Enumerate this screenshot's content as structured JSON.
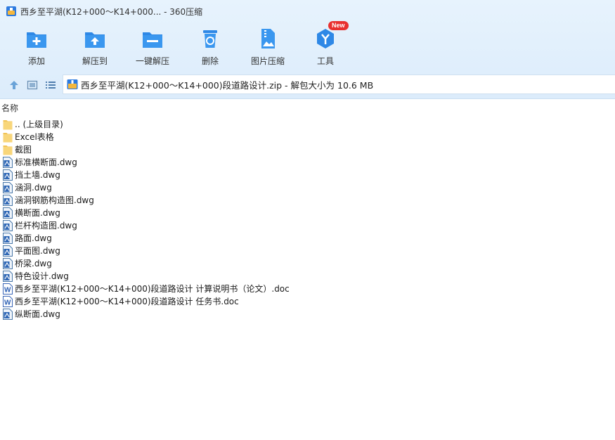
{
  "window": {
    "title": "西乡至平湖(K12+000～K14+000... - 360压缩"
  },
  "toolbar": {
    "buttons": [
      {
        "label": "添加",
        "icon": "add-file-icon"
      },
      {
        "label": "解压到",
        "icon": "extract-to-icon"
      },
      {
        "label": "一键解压",
        "icon": "one-click-extract-icon"
      },
      {
        "label": "删除",
        "icon": "delete-icon"
      },
      {
        "label": "图片压缩",
        "icon": "image-compress-icon"
      },
      {
        "label": "工具",
        "icon": "tools-icon",
        "badge": "New"
      }
    ]
  },
  "navigation": {
    "address": "西乡至平湖(K12+000～K14+000)段道路设计.zip - 解包大小为 10.6 MB"
  },
  "list": {
    "column_name": "名称",
    "items": [
      {
        "name": ".. (上级目录)",
        "type": "folder"
      },
      {
        "name": "Excel表格",
        "type": "folder"
      },
      {
        "name": "截图",
        "type": "folder"
      },
      {
        "name": "标准横断面.dwg",
        "type": "dwg"
      },
      {
        "name": "挡土墙.dwg",
        "type": "dwg"
      },
      {
        "name": "涵洞.dwg",
        "type": "dwg"
      },
      {
        "name": "涵洞钢筋构造图.dwg",
        "type": "dwg"
      },
      {
        "name": "横断面.dwg",
        "type": "dwg"
      },
      {
        "name": "栏杆构造图.dwg",
        "type": "dwg"
      },
      {
        "name": "路面.dwg",
        "type": "dwg"
      },
      {
        "name": "平面图.dwg",
        "type": "dwg"
      },
      {
        "name": "桥梁.dwg",
        "type": "dwg"
      },
      {
        "name": "特色设计.dwg",
        "type": "dwg"
      },
      {
        "name": "西乡至平湖(K12+000～K14+000)段道路设计  计算说明书（论文）.doc",
        "type": "doc"
      },
      {
        "name": "西乡至平湖(K12+000～K14+000)段道路设计 任务书.doc",
        "type": "doc"
      },
      {
        "name": "纵断面.dwg",
        "type": "dwg"
      }
    ]
  },
  "colors": {
    "chrome_bg": "#e2effc",
    "accent_blue": "#2e88e6",
    "folder_yellow": "#f6cf6a",
    "badge_red": "#e8302f"
  }
}
